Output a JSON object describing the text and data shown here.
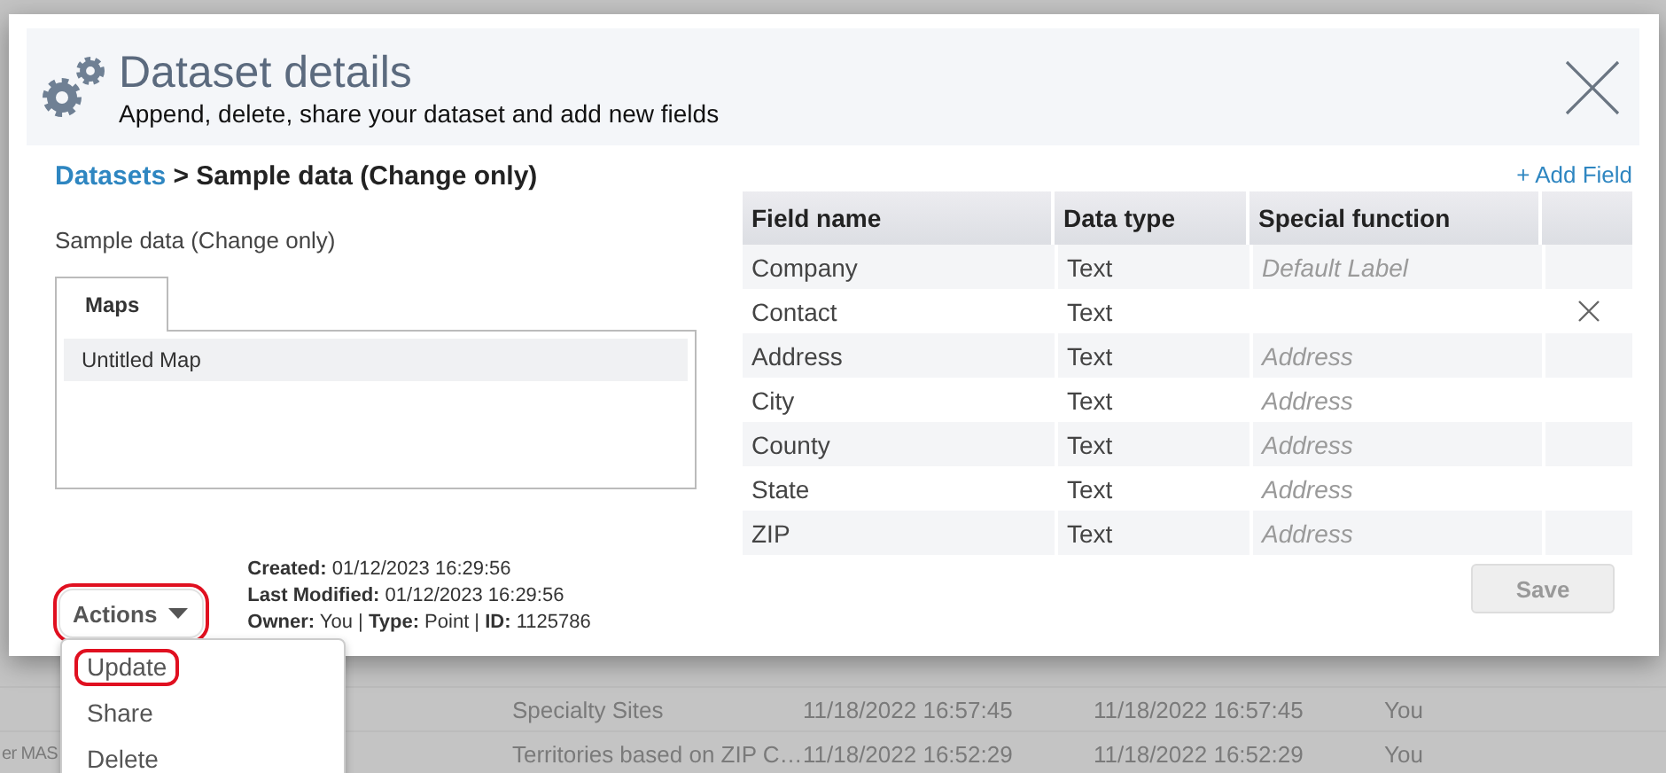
{
  "background_table": {
    "rows_below_dialog": [
      {
        "column_2": "Specialty Sites",
        "column_3": "11/18/2022 16:57:45",
        "column_4": "11/18/2022 16:57:45",
        "column_5": "You"
      },
      {
        "column_1": "er MAS",
        "column_2": "Territories based on ZIP C…",
        "column_3": "11/18/2022 16:52:29",
        "column_4": "11/18/2022 16:52:29",
        "column_5": "You"
      }
    ]
  },
  "dialog": {
    "title": "Dataset details",
    "subtitle": "Append, delete, share your dataset and add new fields",
    "breadcrumb": {
      "link": "Datasets",
      "current": "> Sample data (Change only)"
    },
    "dataset_name": "Sample data (Change only)",
    "tabs": [
      {
        "label": "Maps",
        "selected": true
      }
    ],
    "maps": [
      {
        "name": "Untitled Map",
        "selected": true
      }
    ],
    "actions_button": {
      "label": "Actions",
      "highlighted": true
    },
    "actions_menu": [
      {
        "label": "Update",
        "highlighted": true
      },
      {
        "label": "Share",
        "highlighted": false
      },
      {
        "label": "Delete",
        "highlighted": false
      }
    ],
    "meta": [
      "**Created:** 01/12/2023 16:29:56",
      "**Last Modified:** 01/12/2023 16:29:56",
      "**Owner:** You | **Type:** Point | **ID:** 1125786"
    ],
    "add_field_link": "+ Add Field",
    "fields_table": {
      "columns": [
        "Field name",
        "Data type",
        "Special function"
      ],
      "rows": [
        {
          "field_name": "Company",
          "data_type": "Text",
          "special_function": "Default Label",
          "removable": false
        },
        {
          "field_name": "Contact",
          "data_type": "Text",
          "removable": true
        },
        {
          "field_name": "Address",
          "data_type": "Text",
          "special_function": "Address",
          "removable": false
        },
        {
          "field_name": "City",
          "data_type": "Text",
          "special_function": "Address",
          "removable": false
        },
        {
          "field_name": "County",
          "data_type": "Text",
          "special_function": "Address",
          "removable": false
        },
        {
          "field_name": "State",
          "data_type": "Text",
          "special_function": "Address",
          "removable": false
        },
        {
          "field_name": "ZIP",
          "data_type": "Text",
          "special_function": "Address",
          "removable": false
        }
      ]
    },
    "save_button": {
      "label": "Save",
      "disabled": true
    }
  }
}
